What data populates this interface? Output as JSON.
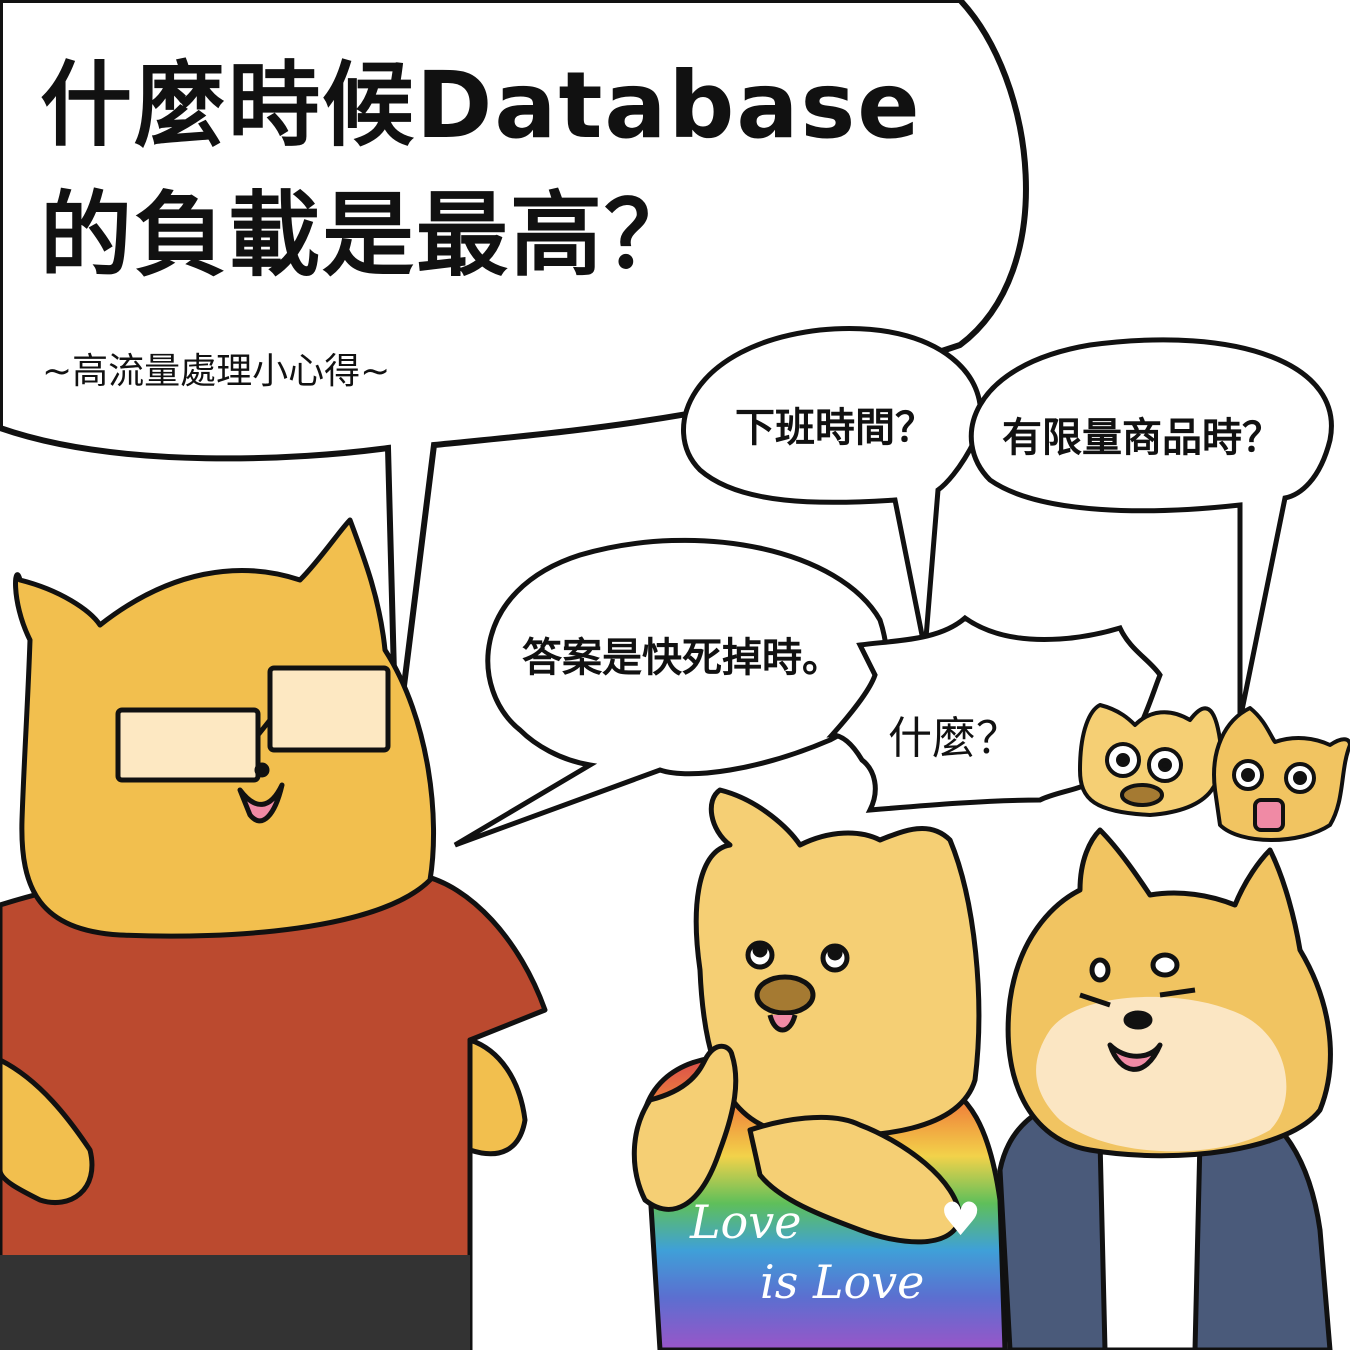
{
  "title": {
    "line1": "什麼時候Database",
    "line2": "的負載是最高？"
  },
  "subtitle": "~高流量處理小心得~",
  "bubbles": {
    "after_work": "下班時間？",
    "limited_goods": "有限量商品時？",
    "answer": "答案是快死掉時。",
    "what": "什麼？"
  },
  "shirt": {
    "line1": "Love",
    "line2": "is Love",
    "heart": "♥"
  },
  "colors": {
    "bear_fur": "#f2bf4e",
    "red_shirt": "#bb4a2f",
    "navy_jacket": "#4a5a7a",
    "dog_fur": "#f5cf74",
    "outline": "#111111"
  }
}
